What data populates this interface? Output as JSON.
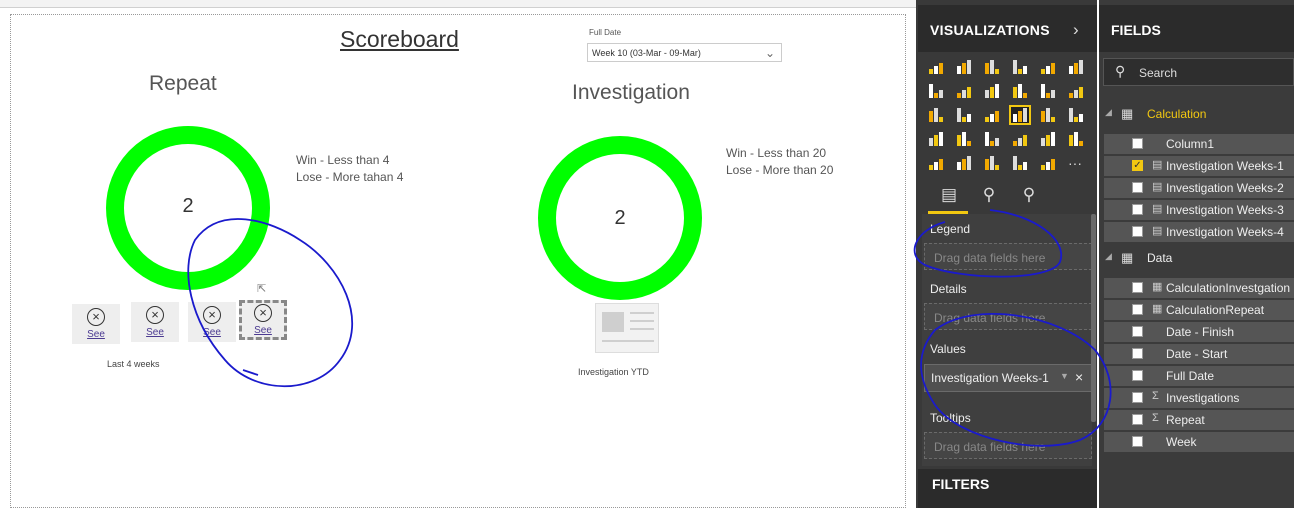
{
  "report": {
    "title": "Scoreboard",
    "slicer": {
      "label": "Full Date",
      "value": "Week 10 (03-Mar - 09-Mar)"
    },
    "repeat": {
      "title": "Repeat",
      "value": "2",
      "legend": [
        "Win - Less than 4",
        "Lose - More tahan 4"
      ],
      "buttons": [
        "See",
        "See",
        "See",
        "See"
      ],
      "caption": "Last 4 weeks"
    },
    "investigation": {
      "title": "Investigation",
      "value": "2",
      "legend": [
        "Win - Less than 20",
        "Lose - More than 20"
      ],
      "caption": "Investigation YTD"
    }
  },
  "visualizations": {
    "title": "VISUALIZATIONS",
    "wells": {
      "legend": {
        "label": "Legend",
        "placeholder": "Drag data fields here"
      },
      "details": {
        "label": "Details",
        "placeholder": "Drag data fields here"
      },
      "values": {
        "label": "Values",
        "field": "Investigation Weeks-1"
      },
      "tooltips": {
        "label": "Tooltips",
        "placeholder": "Drag data fields here"
      }
    }
  },
  "filters": {
    "title": "FILTERS"
  },
  "fields": {
    "title": "FIELDS",
    "search_placeholder": "Search",
    "tables": [
      {
        "name": "Calculation",
        "items": [
          {
            "name": "Column1",
            "checked": false,
            "type": ""
          },
          {
            "name": "Investigation Weeks-1",
            "checked": true,
            "type": "calc"
          },
          {
            "name": "Investigation Weeks-2",
            "checked": false,
            "type": "calc"
          },
          {
            "name": "Investigation Weeks-3",
            "checked": false,
            "type": "calc"
          },
          {
            "name": "Investigation Weeks-4",
            "checked": false,
            "type": "calc"
          }
        ]
      },
      {
        "name": "Data",
        "items": [
          {
            "name": "CalculationInvestgation",
            "checked": false,
            "type": "table"
          },
          {
            "name": "CalculationRepeat",
            "checked": false,
            "type": "table"
          },
          {
            "name": "Date - Finish",
            "checked": false,
            "type": ""
          },
          {
            "name": "Date - Start",
            "checked": false,
            "type": ""
          },
          {
            "name": "Full Date",
            "checked": false,
            "type": ""
          },
          {
            "name": "Investigations",
            "checked": false,
            "type": "sum"
          },
          {
            "name": "Repeat",
            "checked": false,
            "type": "sum"
          },
          {
            "name": "Week",
            "checked": false,
            "type": ""
          }
        ]
      }
    ]
  },
  "colors": {
    "donut": "#00ff00",
    "accent": "#f2c811",
    "annotation": "#1a1acc"
  }
}
